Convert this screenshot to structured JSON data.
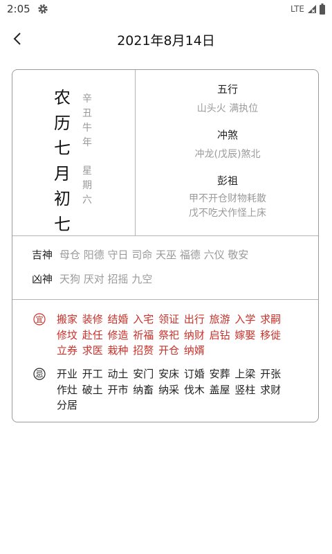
{
  "status": {
    "time": "2:05",
    "network": "LTE"
  },
  "header": {
    "title": "2021年8月14日"
  },
  "lunar": {
    "date_chars": [
      "农",
      "历",
      "七",
      "月",
      "初",
      "七"
    ],
    "year_chars": [
      "辛",
      "丑",
      "牛",
      "年"
    ],
    "weekday_chars": [
      "星",
      "期",
      "六"
    ]
  },
  "wuxing": {
    "label": "五行",
    "value": "山头火 满执位"
  },
  "chongsha": {
    "label": "冲煞",
    "value": "冲龙(戊辰)煞北"
  },
  "pengzu": {
    "label": "彭祖",
    "line1": "甲不开仓财物耗散",
    "line2": "戊不吃犬作怪上床"
  },
  "jishen": {
    "label": "吉神",
    "value": "母仓 阳德 守日 司命 天巫 福德 六仪 敬安"
  },
  "xiongshen": {
    "label": "凶神",
    "value": "天狗 厌对 招摇 九空"
  },
  "yi": {
    "icon": "yi-seal-icon",
    "icon_char": "宜",
    "lines": [
      "搬家 装修 结婚 入宅 领证 出行 旅游 入学 求嗣",
      "修坟 赴任 修造 祈福 祭祀 纳财 启钻 嫁娶 移徙",
      "立券 求医 栽种 招赘 开仓 纳婿"
    ],
    "color": "#c9312a"
  },
  "ji": {
    "icon": "ji-seal-icon",
    "icon_char": "忌",
    "lines": [
      "开业 开工 动土 安门 安床 订婚 安葬 上梁 开张",
      "作灶 破土 开市 纳畜 纳采 伐木 盖屋 竖柱 求财",
      "分居"
    ]
  }
}
